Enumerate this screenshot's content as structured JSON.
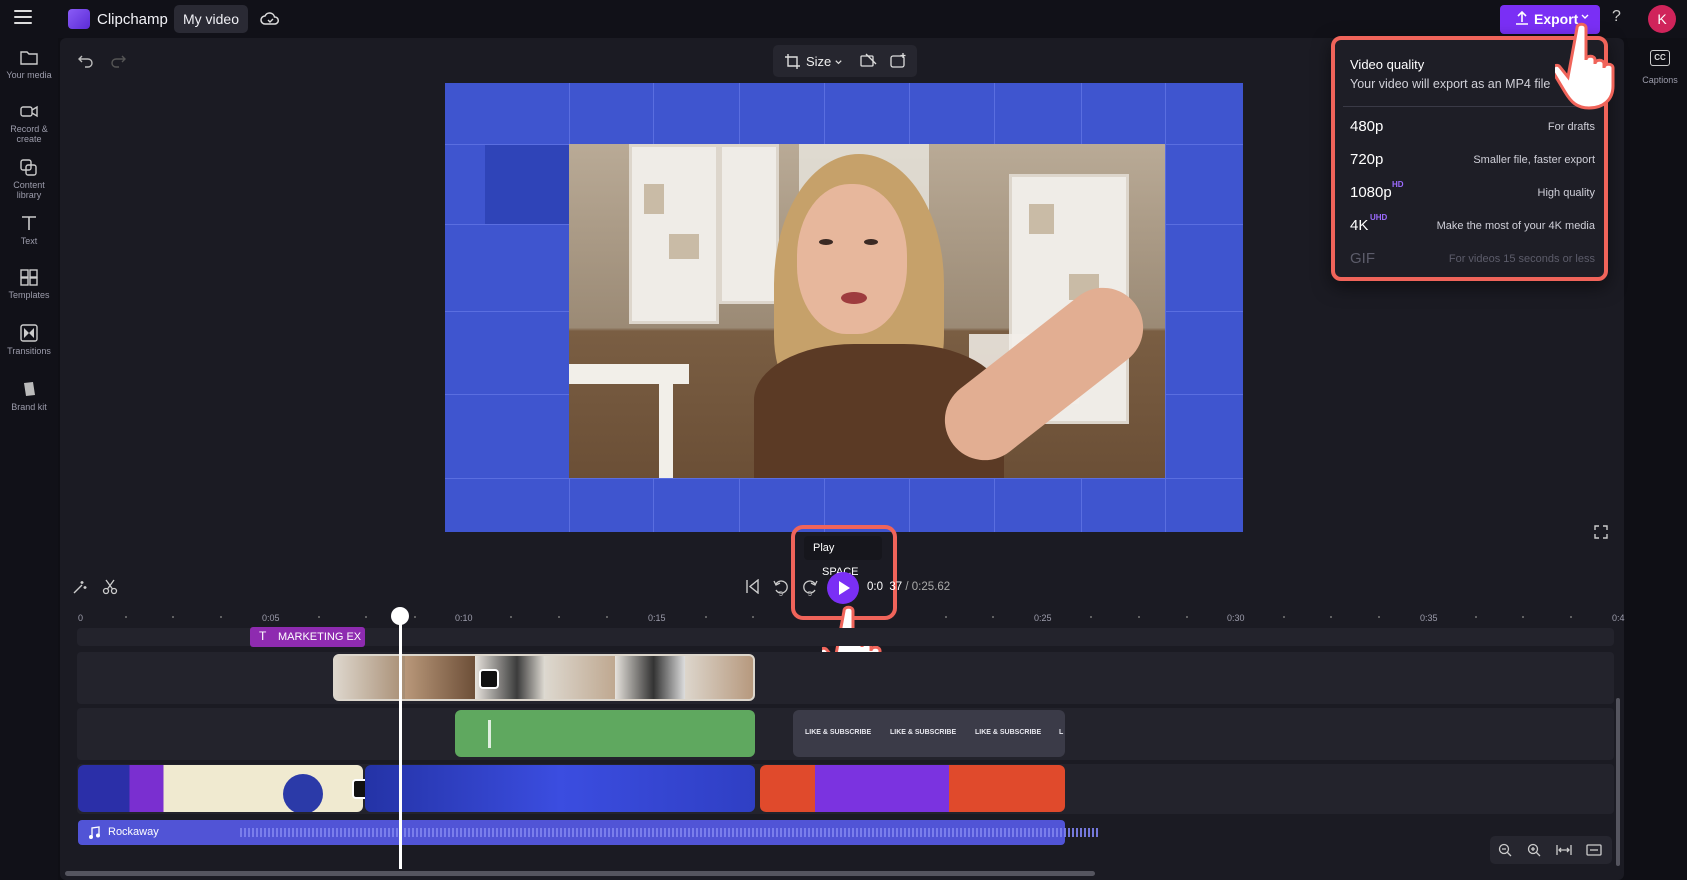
{
  "app": {
    "name": "Clipchamp",
    "project_name": "My video",
    "user_initial": "K",
    "help": "?"
  },
  "colors": {
    "accent": "#7a2ff5",
    "highlight": "#f0645a",
    "preview_bg": "#3f55cf"
  },
  "sidebar": {
    "items": [
      {
        "label": "Your media",
        "icon": "folder-icon"
      },
      {
        "label": "Record &\ncreate",
        "icon": "camera-icon"
      },
      {
        "label": "Content\nlibrary",
        "icon": "library-icon"
      },
      {
        "label": "Text",
        "icon": "text-icon"
      },
      {
        "label": "Templates",
        "icon": "templates-icon"
      },
      {
        "label": "Transitions",
        "icon": "transitions-icon"
      },
      {
        "label": "Brand kit",
        "icon": "brand-kit-icon"
      }
    ]
  },
  "right_panel": {
    "captions_label": "Captions",
    "captions_icon_text": "CC"
  },
  "toolbar": {
    "export_label": "Export",
    "size_label": "Size"
  },
  "export_popup": {
    "title": "Video quality",
    "subtitle": "Your video will export as an MP4 file",
    "options": [
      {
        "name": "480p",
        "badge": "",
        "desc": "For drafts",
        "enabled": true
      },
      {
        "name": "720p",
        "badge": "",
        "desc": "Smaller file, faster export",
        "enabled": true
      },
      {
        "name": "1080p",
        "badge": "HD",
        "desc": "High quality",
        "enabled": true
      },
      {
        "name": "4K",
        "badge": "UHD",
        "desc": "Make the most of your 4K media",
        "enabled": true
      },
      {
        "name": "GIF",
        "badge": "",
        "desc": "For videos 15 seconds or less",
        "enabled": false
      }
    ]
  },
  "playback": {
    "tooltip_action": "Play",
    "tooltip_key": "SPACE",
    "current_time": "0:0",
    "current_time_tail": "37",
    "total_time": "/ 0:25.62"
  },
  "timeline": {
    "ruler": [
      "0",
      "0:05",
      "0:10",
      "0:15",
      "0:25",
      "0:30",
      "0:35",
      "0:4"
    ],
    "text_clip_label": "MARKETING EX",
    "like_clip_labels": [
      "LIKE & SUBSCRIBE",
      "LIKE & SUBSCRIBE",
      "LIKE & SUBSCRIBE",
      "L"
    ],
    "audio_clip_label": "Rockaway"
  }
}
